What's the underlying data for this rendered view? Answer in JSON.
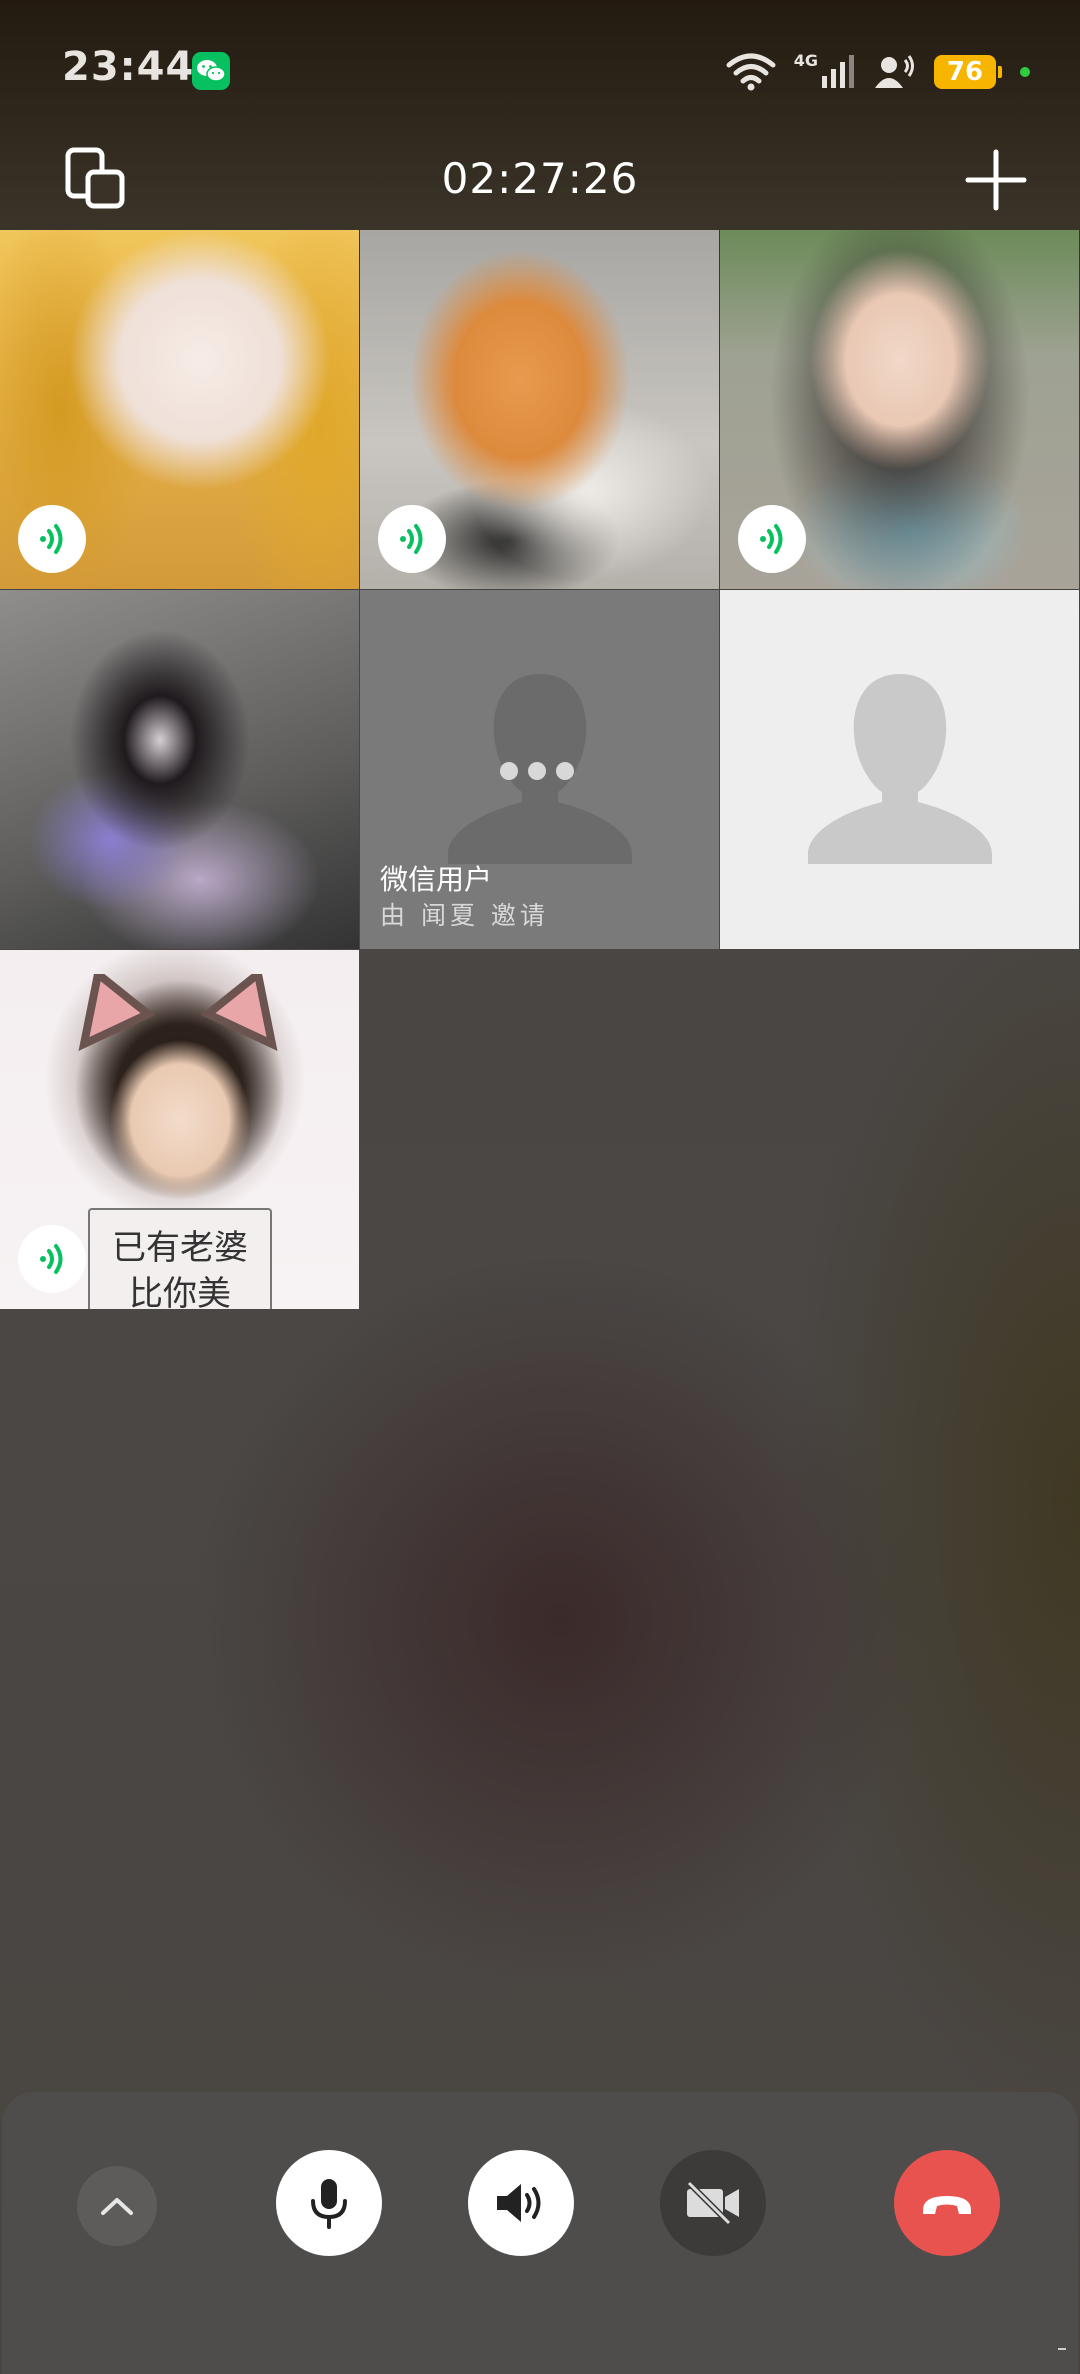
{
  "status_bar": {
    "time": "23:44",
    "network": "4G",
    "battery": "76",
    "icons": [
      "wechat-icon",
      "wifi-icon",
      "signal-icon",
      "hotspot-user-icon",
      "battery-icon"
    ]
  },
  "header": {
    "call_timer": "02:27:26",
    "icons": [
      "minimize-window-icon",
      "add-participant-icon"
    ]
  },
  "participants": [
    {
      "id": "p1",
      "speaking": true
    },
    {
      "id": "p2",
      "speaking": true
    },
    {
      "id": "p3",
      "speaking": true
    },
    {
      "id": "p4",
      "speaking": false
    },
    {
      "id": "p5",
      "name": "微信用户",
      "status": "由 闻夏 邀请",
      "state": "waiting"
    },
    {
      "id": "p6",
      "state": "placeholder"
    },
    {
      "id": "p7",
      "speaking": true,
      "sign_line1": "已有老婆",
      "sign_line2": "比你美"
    }
  ],
  "controls": {
    "items": [
      "expand-icon",
      "microphone-icon",
      "speaker-icon",
      "camera-off-icon",
      "hang-up-icon"
    ],
    "colors": {
      "hangup": "#e9534f",
      "active": "#ffffff",
      "inactive": "#3c3b3a"
    }
  },
  "colors": {
    "speaking_green": "#07c160",
    "battery": "#f7b500"
  }
}
